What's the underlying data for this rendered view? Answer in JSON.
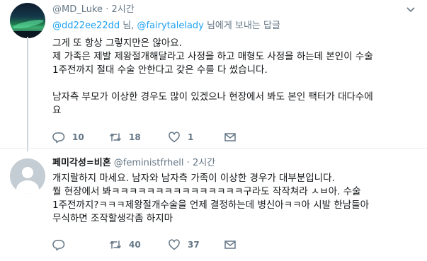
{
  "tweets": [
    {
      "display_name": "",
      "handle": "@MD_Luke",
      "separator": "·",
      "time": "2시간",
      "reply_to": {
        "prefix": "",
        "mention1": "@dd22ee22dd",
        "mid": " 님, ",
        "mention2": "@fairytalelady",
        "suffix": " 님에게 보내는 답글"
      },
      "lines": [
        "그게 또 항상 그렇지만은 않아요.",
        "제 가족은 제발 제왕절개해달라고 사정을 하고 매형도 사정을 하는데 본인이 수술",
        "1주전까지 절대 수술 안한다고 갖은 수를 다 썼습니다.",
        "",
        "남자측 부모가 이상한 경우도 많이 있겠으나 현장에서 봐도 본인 팩터가 대다수에",
        "요"
      ],
      "reply_count": "10",
      "retweet_count": "18",
      "like_count": "1",
      "avatar_icon": "aurora-photo"
    },
    {
      "display_name": "페미각성=비혼",
      "handle": "@feministfrhell",
      "separator": "·",
      "time": "2시간",
      "lines": [
        "개지랄하지 마세요.  남자와 남자측 가족이 이상한 경우가 대부분입니다.",
        "뭘 현장에서 봐ㅋㅋㅋㅋㅋㅋㅋㅋㅋㅋㅋㅋㅋㅋㅋ구라도 작작쳐라 ㅅㅂ아. 수술",
        "1주전까지?ㅋㅋㅋ제왕절개수술을 언제 결정하는데 병신아ㅋㅋ아 시발 한남들아",
        "무식하면 조작할생각좀 하지마"
      ],
      "reply_count": "",
      "retweet_count": "40",
      "like_count": "37",
      "avatar_icon": "default-avatar"
    }
  ],
  "colors": {
    "text": "#14171a",
    "muted": "#657786",
    "link": "#1da1f2",
    "thread_line": "#ccd6dd",
    "divider": "#e6ecf0"
  }
}
